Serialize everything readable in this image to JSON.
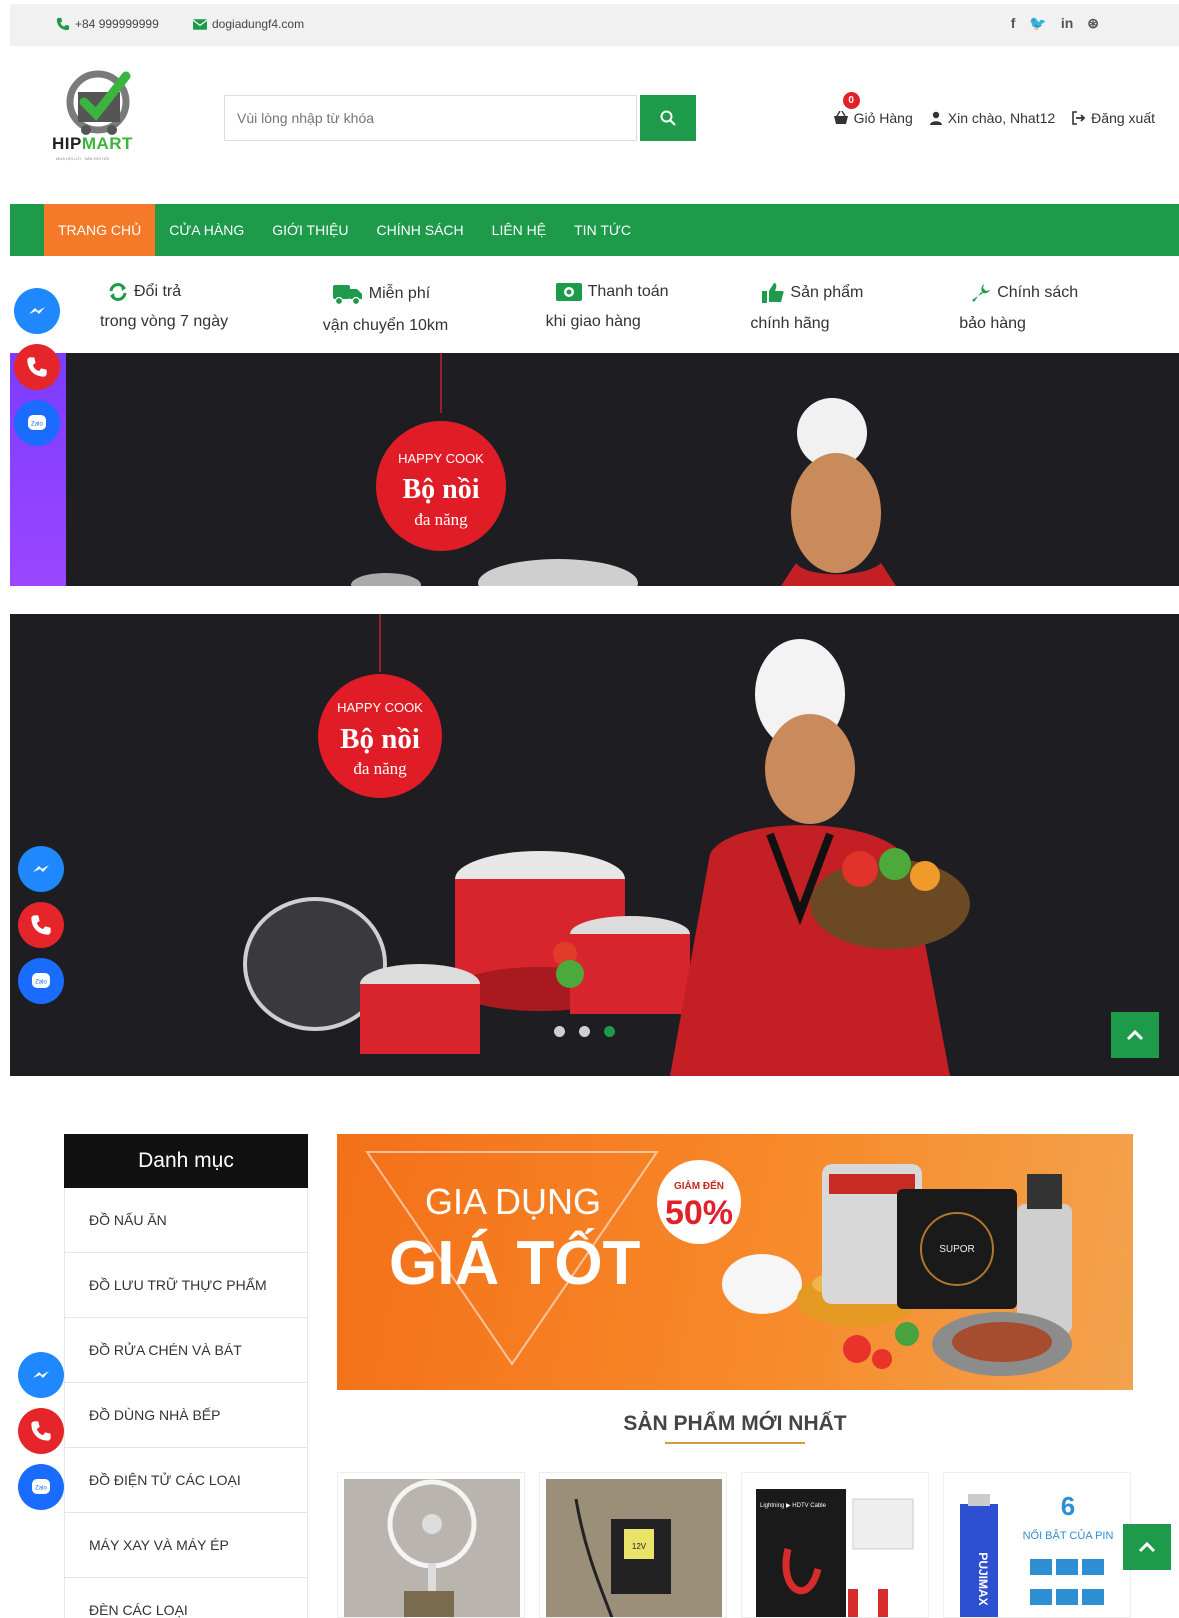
{
  "topbar": {
    "phone": "+84 999999999",
    "email": "dogiadungf4.com",
    "social": [
      "f",
      "𝕪",
      "in",
      "⊛"
    ]
  },
  "header": {
    "logo_text": "HIPMART",
    "logo_tagline": "MUA HỘI LỚI · SẢN HỘI HỘI",
    "search_placeholder": "Vùi lòng nhập từ khóa",
    "cart_label": "Giỏ Hàng",
    "cart_count": "0",
    "greeting": "Xin chào, Nhat12",
    "logout": "Đăng xuất"
  },
  "nav": [
    "TRANG CHỦ",
    "CỬA HÀNG",
    "GIỚI THIỆU",
    "CHÍNH SÁCH",
    "LIÊN HỆ",
    "TIN TỨC"
  ],
  "features": [
    {
      "l1": "Đổi trả",
      "l2": "trong vòng 7 ngày",
      "icon": "refresh-icon"
    },
    {
      "l1": "Miễn phí",
      "l2": "vận chuyển 10km",
      "icon": "truck-icon"
    },
    {
      "l1": "Thanh toán",
      "l2": "khi giao hàng",
      "icon": "money-icon"
    },
    {
      "l1": "Sản phẩm",
      "l2": "chính hãng",
      "icon": "thumbs-up-icon"
    },
    {
      "l1": "Chính sách",
      "l2": "bảo hàng",
      "icon": "wrench-icon"
    }
  ],
  "banner": {
    "tag_top": "HAPPY COOK",
    "tag_main": "Bộ nồi",
    "tag_sub": "đa năng"
  },
  "sidebar": {
    "title": "Danh mục",
    "categories": [
      "ĐỒ NẤU ĂN",
      "ĐỒ LƯU TRỮ THỰC PHẨM",
      "ĐỒ RỬA CHÉN VÀ BÁT",
      "ĐỒ DÙNG NHÀ BẾP",
      "ĐỒ ĐIỆN TỬ CÁC LOẠI",
      "MÁY XAY VÀ MÁY ÉP",
      "ĐÈN CÁC LOẠI"
    ]
  },
  "promo": {
    "line1": "GIA DỤNG",
    "line2": "GIÁ TỐT",
    "badge_top": "GIẢM ĐẾN",
    "badge_value": "50%",
    "brand": "SUPOR"
  },
  "section_title": "SẢN PHẨM MỚI NHẤT",
  "products": [
    {
      "label": ""
    },
    {
      "label": "12V"
    },
    {
      "label": "Lightning ▶ HDTV Cable"
    },
    {
      "label": "NỔI BẬT CỦA PIN",
      "brand": "PUJIMAX",
      "num": "6"
    }
  ],
  "colors": {
    "primary": "#1d9a4a",
    "accent": "#f47a2a",
    "badge": "#e0202a"
  }
}
